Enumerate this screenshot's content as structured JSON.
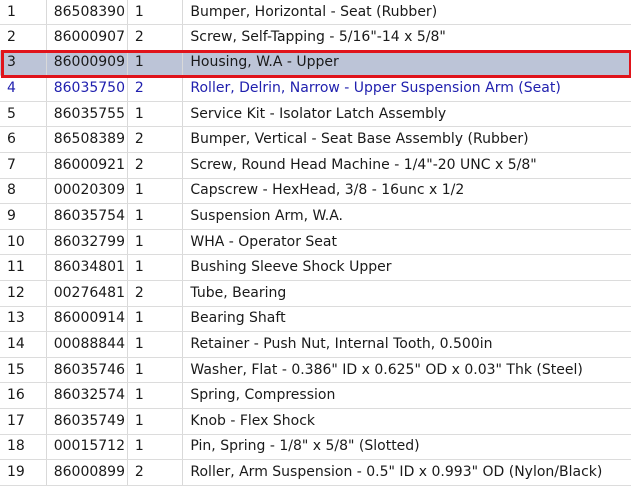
{
  "parts_list": {
    "selected_index": 2,
    "link_index": 3,
    "colors": {
      "selected_row": "#bcc4d7",
      "selection_outline": "#e0141b",
      "link_text": "#1f1fae"
    },
    "rows": [
      {
        "item": "1",
        "part_number": "86508390",
        "qty": "1",
        "description": "Bumper, Horizontal - Seat (Rubber)"
      },
      {
        "item": "2",
        "part_number": "86000907",
        "qty": "2",
        "description": "Screw, Self-Tapping - 5/16\"-14 x 5/8\""
      },
      {
        "item": "3",
        "part_number": "86000909",
        "qty": "1",
        "description": "Housing, W.A - Upper"
      },
      {
        "item": "4",
        "part_number": "86035750",
        "qty": "2",
        "description": "Roller, Delrin, Narrow - Upper Suspension Arm (Seat)"
      },
      {
        "item": "5",
        "part_number": "86035755",
        "qty": "1",
        "description": "Service Kit - Isolator Latch Assembly"
      },
      {
        "item": "6",
        "part_number": "86508389",
        "qty": "2",
        "description": "Bumper, Vertical - Seat Base Assembly (Rubber)"
      },
      {
        "item": "7",
        "part_number": "86000921",
        "qty": "2",
        "description": "Screw, Round Head Machine - 1/4\"-20 UNC x 5/8\""
      },
      {
        "item": "8",
        "part_number": "00020309",
        "qty": "1",
        "description": "Capscrew - HexHead, 3/8 - 16unc x 1/2"
      },
      {
        "item": "9",
        "part_number": "86035754",
        "qty": "1",
        "description": "Suspension Arm, W.A."
      },
      {
        "item": "10",
        "part_number": "86032799",
        "qty": "1",
        "description": "WHA - Operator Seat"
      },
      {
        "item": "11",
        "part_number": "86034801",
        "qty": "1",
        "description": "Bushing Sleeve Shock Upper"
      },
      {
        "item": "12",
        "part_number": "00276481",
        "qty": "2",
        "description": "Tube, Bearing"
      },
      {
        "item": "13",
        "part_number": "86000914",
        "qty": "1",
        "description": "Bearing Shaft"
      },
      {
        "item": "14",
        "part_number": "00088844",
        "qty": "1",
        "description": "Retainer - Push Nut, Internal Tooth, 0.500in"
      },
      {
        "item": "15",
        "part_number": "86035746",
        "qty": "1",
        "description": "Washer, Flat - 0.386\" ID x 0.625\" OD x 0.03\" Thk (Steel)"
      },
      {
        "item": "16",
        "part_number": "86032574",
        "qty": "1",
        "description": "Spring, Compression"
      },
      {
        "item": "17",
        "part_number": "86035749",
        "qty": "1",
        "description": "Knob - Flex Shock"
      },
      {
        "item": "18",
        "part_number": "00015712",
        "qty": "1",
        "description": "Pin, Spring - 1/8\" x 5/8\" (Slotted)"
      },
      {
        "item": "19",
        "part_number": "86000899",
        "qty": "2",
        "description": "Roller, Arm Suspension - 0.5\" ID x 0.993\" OD (Nylon/Black)"
      }
    ]
  }
}
